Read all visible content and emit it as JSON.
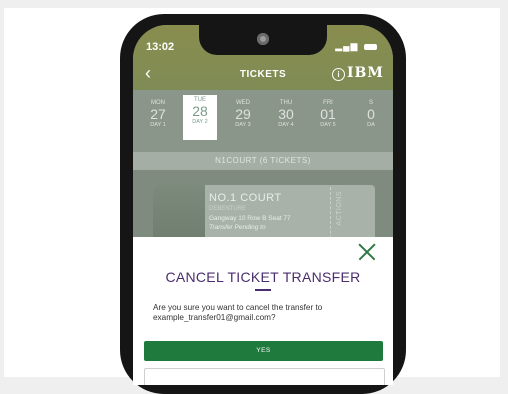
{
  "status_bar": {
    "time": "13:02"
  },
  "header": {
    "title": "TICKETS",
    "brand": "IBM"
  },
  "days": [
    {
      "name": "MON",
      "date": "27",
      "label": "DAY 1"
    },
    {
      "name": "TUE",
      "date": "28",
      "label": "DAY 2",
      "selected": true
    },
    {
      "name": "WED",
      "date": "29",
      "label": "DAY 3"
    },
    {
      "name": "THU",
      "date": "30",
      "label": "DAY 4"
    },
    {
      "name": "FRI",
      "date": "01",
      "label": "DAY 5"
    },
    {
      "name": "S",
      "date": "0",
      "label": "DA"
    }
  ],
  "court_section": {
    "label": "N1COURT (6 TICKETS)"
  },
  "ticket": {
    "court": "NO.1 COURT",
    "type": "DEBENTURE",
    "seat": "Gangway 10 Row B Seat 77",
    "status": "Transfer Pending to",
    "actions_label": "ACTIONS"
  },
  "modal": {
    "title": "CANCEL TICKET TRANSFER",
    "message": "Are you sure you want to cancel the transfer to example_transfer01@gmail.com?",
    "yes_label": "YES"
  },
  "colors": {
    "header": "#898d4e",
    "accent_green": "#1f7a3e",
    "modal_title": "#4a2d6e"
  }
}
